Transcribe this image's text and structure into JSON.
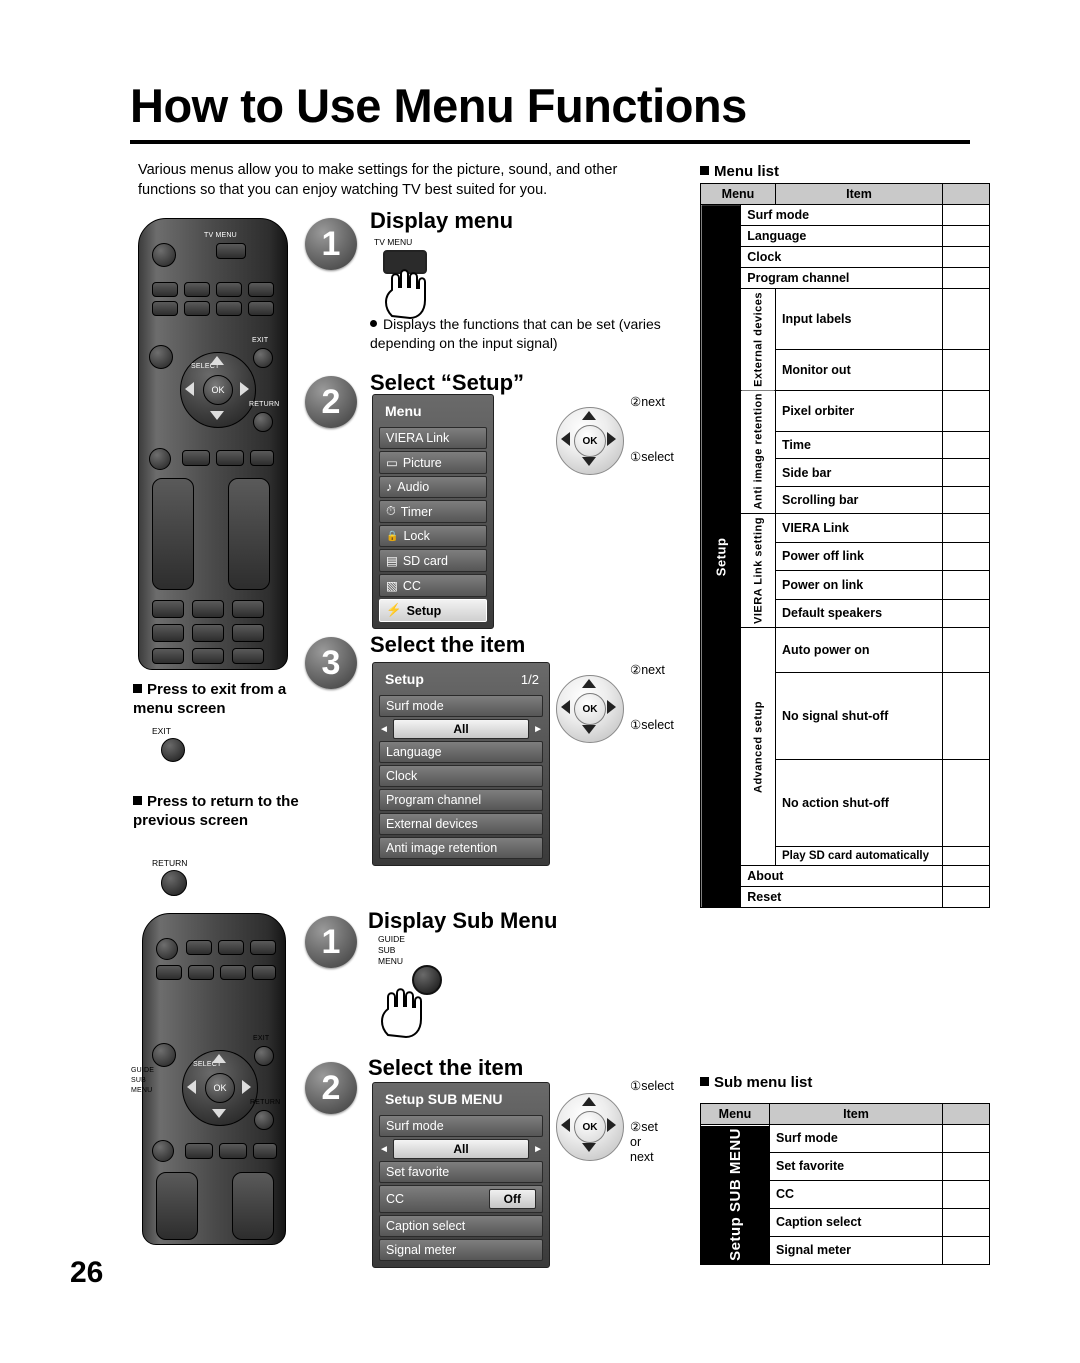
{
  "page": {
    "title": "How to Use Menu Functions",
    "number": "26",
    "intro": "Various menus allow you to make settings for the picture, sound, and other functions so that you can enjoy watching TV best suited for you."
  },
  "steps": {
    "s1_num": "1",
    "s1_title": "Display menu",
    "s1_btn_label": "TV MENU",
    "s1_note": "Displays the functions that can be set (varies depending on the input signal)",
    "s2_num": "2",
    "s2_title": "Select “Setup”",
    "s3_num": "3",
    "s3_title": "Select the item",
    "s4_num": "1",
    "s4_title": "Display Sub Menu",
    "s4_btn_label": "GUIDE SUB MENU",
    "s5_num": "2",
    "s5_title": "Select the item"
  },
  "remote1": {
    "tv_menu": "TV MENU",
    "exit": "EXIT",
    "select": "SELECT",
    "ok": "OK",
    "return": "RETURN"
  },
  "remote2": {
    "guide": "GUIDE",
    "sub": "SUB",
    "menu": "MENU",
    "exit": "EXIT",
    "select": "SELECT",
    "ok": "OK",
    "return": "RETURN"
  },
  "menu_panel": {
    "title": "Menu",
    "items": [
      {
        "label": "VIERA Link",
        "icon": ""
      },
      {
        "label": "Picture",
        "icon": "▭"
      },
      {
        "label": "Audio",
        "icon": "♪"
      },
      {
        "label": "Timer",
        "icon": "⏱"
      },
      {
        "label": "Lock",
        "icon": "🔒"
      },
      {
        "label": "SD card",
        "icon": "▤"
      },
      {
        "label": "CC",
        "icon": "▧"
      },
      {
        "label": "Setup",
        "icon": "⚡"
      }
    ]
  },
  "setup_panel": {
    "title": "Setup",
    "page": "1/2",
    "first_item": "Surf mode",
    "first_value": "All",
    "items": [
      "Language",
      "Clock",
      "Program channel",
      "External devices",
      "Anti image retention"
    ]
  },
  "submenu_panel": {
    "title": "Setup SUB MENU",
    "first_item": "Surf mode",
    "first_value": "All",
    "items": [
      "Set favorite"
    ],
    "cc_label": "CC",
    "cc_value": "Off",
    "items2": [
      "Caption select",
      "Signal meter"
    ]
  },
  "callouts": {
    "next": "next",
    "select": "select",
    "num1": "①",
    "num2": "②",
    "set_or_next": "set or next",
    "set": "set"
  },
  "tips": {
    "exit_text": "Press to exit from a menu screen",
    "exit_btn": "EXIT",
    "return_text": "Press to return to the previous screen",
    "return_btn": "RETURN"
  },
  "menu_list": {
    "heading": "Menu list",
    "col_menu": "Menu",
    "col_item": "Item",
    "group_setup": "Setup",
    "groups": [
      {
        "vlabel": "",
        "rows": [
          "Surf mode",
          "Language",
          "Clock",
          "Program channel"
        ]
      },
      {
        "vlabel": "External devices",
        "rows": [
          "Input labels",
          "Monitor out"
        ]
      },
      {
        "vlabel": "Anti image retention",
        "rows": [
          "Pixel orbiter",
          "Time",
          "Side bar",
          "Scrolling bar"
        ]
      },
      {
        "vlabel": "VIERA Link setting",
        "rows": [
          "VIERA Link",
          "Power off link",
          "Power on link",
          "Default speakers"
        ]
      },
      {
        "vlabel": "Advanced setup",
        "rows": [
          "Auto power on",
          "No signal shut-off",
          "No action shut-off",
          "Play SD card automatically"
        ]
      },
      {
        "vlabel": "",
        "rows": [
          "About",
          "Reset"
        ]
      }
    ]
  },
  "sub_menu_list": {
    "heading": "Sub menu list",
    "col_menu": "Menu",
    "col_item": "Item",
    "group": "Setup SUB MENU",
    "rows": [
      "Surf mode",
      "Set favorite",
      "CC",
      "Caption select",
      "Signal meter"
    ]
  }
}
